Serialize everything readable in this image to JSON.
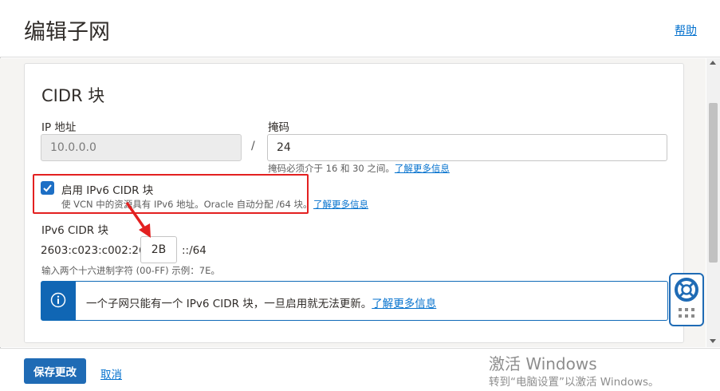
{
  "header": {
    "title": "编辑子网",
    "help_label": "帮助"
  },
  "cidr_section": {
    "title": "CIDR 块",
    "ip_label": "IP 地址",
    "ip_value": "10.0.0.0",
    "separator": "/",
    "mask_label": "掩码",
    "mask_value": "24",
    "mask_hint": "掩码必须介于 16 和 30 之间。",
    "learn_more": "了解更多信息"
  },
  "ipv6": {
    "checkbox_checked": true,
    "checkbox_label": "启用 IPv6 CIDR 块",
    "checkbox_hint": "使 VCN 中的资源具有 IPv6 地址。Oracle 自动分配 /64 块。",
    "learn_more": "了解更多信息",
    "block_label": "IPv6 CIDR 块",
    "prefix": "2603:c023:c002:26",
    "segment_value": "2B",
    "suffix": "::/64",
    "segment_hint": "输入两个十六进制字符 (00-FF) 示例：7E。"
  },
  "info_banner": {
    "icon": "info-icon",
    "text": "一个子网只能有一个 IPv6 CIDR 块，一旦启用就无法更新。",
    "learn_more": "了解更多信息"
  },
  "footer": {
    "save_label": "保存更改",
    "cancel_label": "取消"
  },
  "watermark": {
    "line1": "激活 Windows",
    "line2": "转到“电脑设置”以激活 Windows。"
  },
  "colors": {
    "accent": "#1f6bb5",
    "link": "#0572ce",
    "annotation": "#e32020"
  }
}
